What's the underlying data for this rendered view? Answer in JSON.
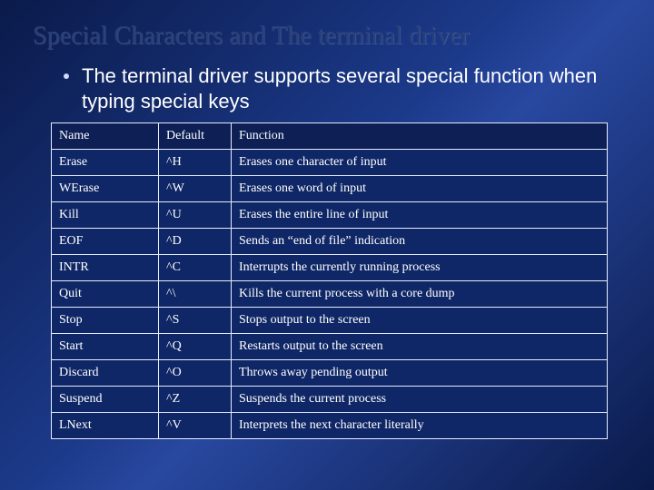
{
  "title": "Special Characters and The terminal driver",
  "bullet": "The terminal driver supports several special function when typing special keys",
  "table": {
    "headers": [
      "Name",
      "Default",
      "Function"
    ],
    "rows": [
      [
        "Erase",
        "^H",
        "Erases one character of input"
      ],
      [
        "WErase",
        "^W",
        "Erases one word of input"
      ],
      [
        "Kill",
        "^U",
        "Erases the entire line of input"
      ],
      [
        "EOF",
        "^D",
        "Sends an “end of file” indication"
      ],
      [
        "INTR",
        "^C",
        "Interrupts the currently running process"
      ],
      [
        "Quit",
        "^\\",
        "Kills the current process with a core dump"
      ],
      [
        "Stop",
        "^S",
        "Stops output to the screen"
      ],
      [
        "Start",
        "^Q",
        "Restarts output to the screen"
      ],
      [
        "Discard",
        "^O",
        "Throws away pending output"
      ],
      [
        "Suspend",
        "^Z",
        "Suspends the current process"
      ],
      [
        "LNext",
        "^V",
        "Interprets the next character literally"
      ]
    ]
  }
}
